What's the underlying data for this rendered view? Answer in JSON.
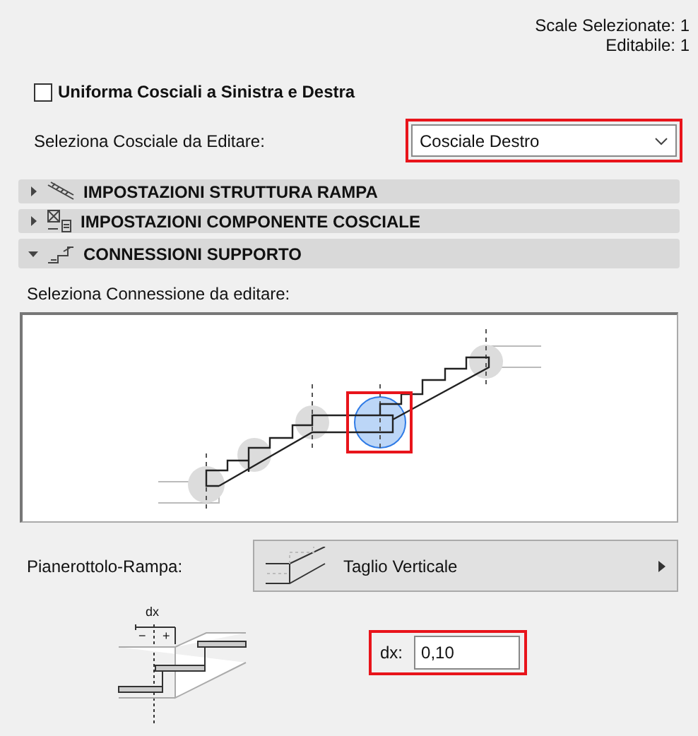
{
  "selection_info": [
    "Scale Selezionate: 1",
    "Editabile: 1"
  ],
  "uniform_checkbox": {
    "label": "Uniforma Cosciali a Sinistra e Destra",
    "checked": false
  },
  "stringer_select": {
    "label": "Seleziona Cosciale da Editare:",
    "value": "Cosciale Destro",
    "highlighted": true
  },
  "sections": [
    {
      "title": "IMPOSTAZIONI STRUTTURA RAMPA",
      "expanded": false,
      "kind": "structure"
    },
    {
      "title": "IMPOSTAZIONI COMPONENTE COSCIALE",
      "expanded": false,
      "kind": "component"
    },
    {
      "title": "CONNESSIONI SUPPORTO",
      "expanded": true,
      "kind": "connection"
    }
  ],
  "connection_picker": {
    "label": "Seleziona Connessione da editare:",
    "connections": [
      {
        "selected": false
      },
      {
        "selected": false
      },
      {
        "selected": false
      },
      {
        "selected": true
      },
      {
        "selected": false
      }
    ]
  },
  "landing_flight": {
    "label": "Pianerottolo-Rampa:",
    "value": "Taglio Verticale"
  },
  "offset_diagram": {
    "dimension": "dx",
    "minus": "−",
    "plus": "+"
  },
  "dx_field": {
    "label": "dx:",
    "value": "0,10",
    "highlighted": true
  }
}
